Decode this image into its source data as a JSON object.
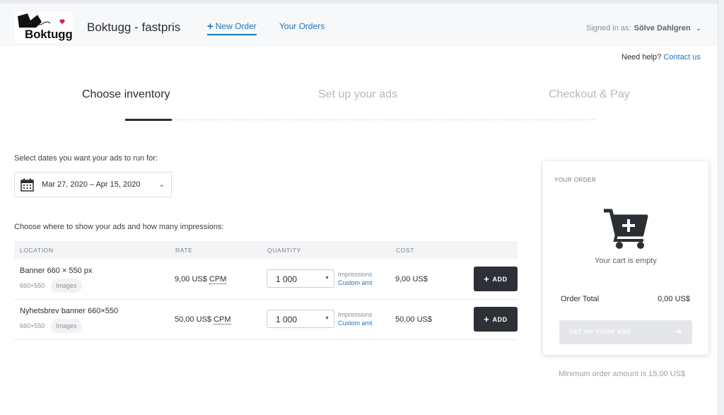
{
  "header": {
    "logo_text": "Boktugg",
    "app_title": "Boktugg - fastpris",
    "nav": [
      {
        "label": "New Order",
        "active": true
      },
      {
        "label": "Your Orders",
        "active": false
      }
    ],
    "signed_in_prefix": "Signed in as:",
    "user_name": "Sölve Dahlgren"
  },
  "help": {
    "text": "Need help?",
    "link": "Contact us"
  },
  "steps": [
    {
      "label": "Choose inventory",
      "active": true
    },
    {
      "label": "Set up your ads",
      "active": false
    },
    {
      "label": "Checkout & Pay",
      "active": false
    }
  ],
  "dates": {
    "label": "Select dates you want your ads to run for:",
    "value": "Mar 27, 2020 – Apr 15, 2020"
  },
  "inventory": {
    "label": "Choose where to show your ads and how many impressions:",
    "columns": [
      "LOCATION",
      "RATE",
      "QUANTITY",
      "COST"
    ],
    "rows": [
      {
        "name": "Banner 660 × 550 px",
        "size": "660×550",
        "tag": "Images",
        "rate_value": "9,00 US$",
        "rate_unit": "CPM",
        "quantity": "1 000",
        "impressions_label": "Impressions",
        "custom_label": "Custom amt",
        "cost": "9,00 US$",
        "add_label": "ADD"
      },
      {
        "name": "Nyhetsbrev banner 660×550",
        "size": "660×550",
        "tag": "Images",
        "rate_value": "50,00 US$",
        "rate_unit": "CPM",
        "quantity": "1 000",
        "impressions_label": "Impressions",
        "custom_label": "Custom amt",
        "cost": "50,00 US$",
        "add_label": "ADD"
      }
    ]
  },
  "order": {
    "title": "YOUR ORDER",
    "empty_text": "Your cart is empty",
    "total_label": "Order Total",
    "total_value": "0,00 US$",
    "button_label": "SET UP YOUR ADS",
    "minimum_text": "Minimum order amount is 15,00 US$"
  },
  "colors": {
    "accent": "#1b75bc",
    "dark_button": "#2d3137",
    "disabled_button": "#e4e6ea"
  },
  "icons": [
    "calendar-icon",
    "chevron-down-icon",
    "cart-add-icon",
    "plus-icon",
    "arrow-right-icon"
  ]
}
